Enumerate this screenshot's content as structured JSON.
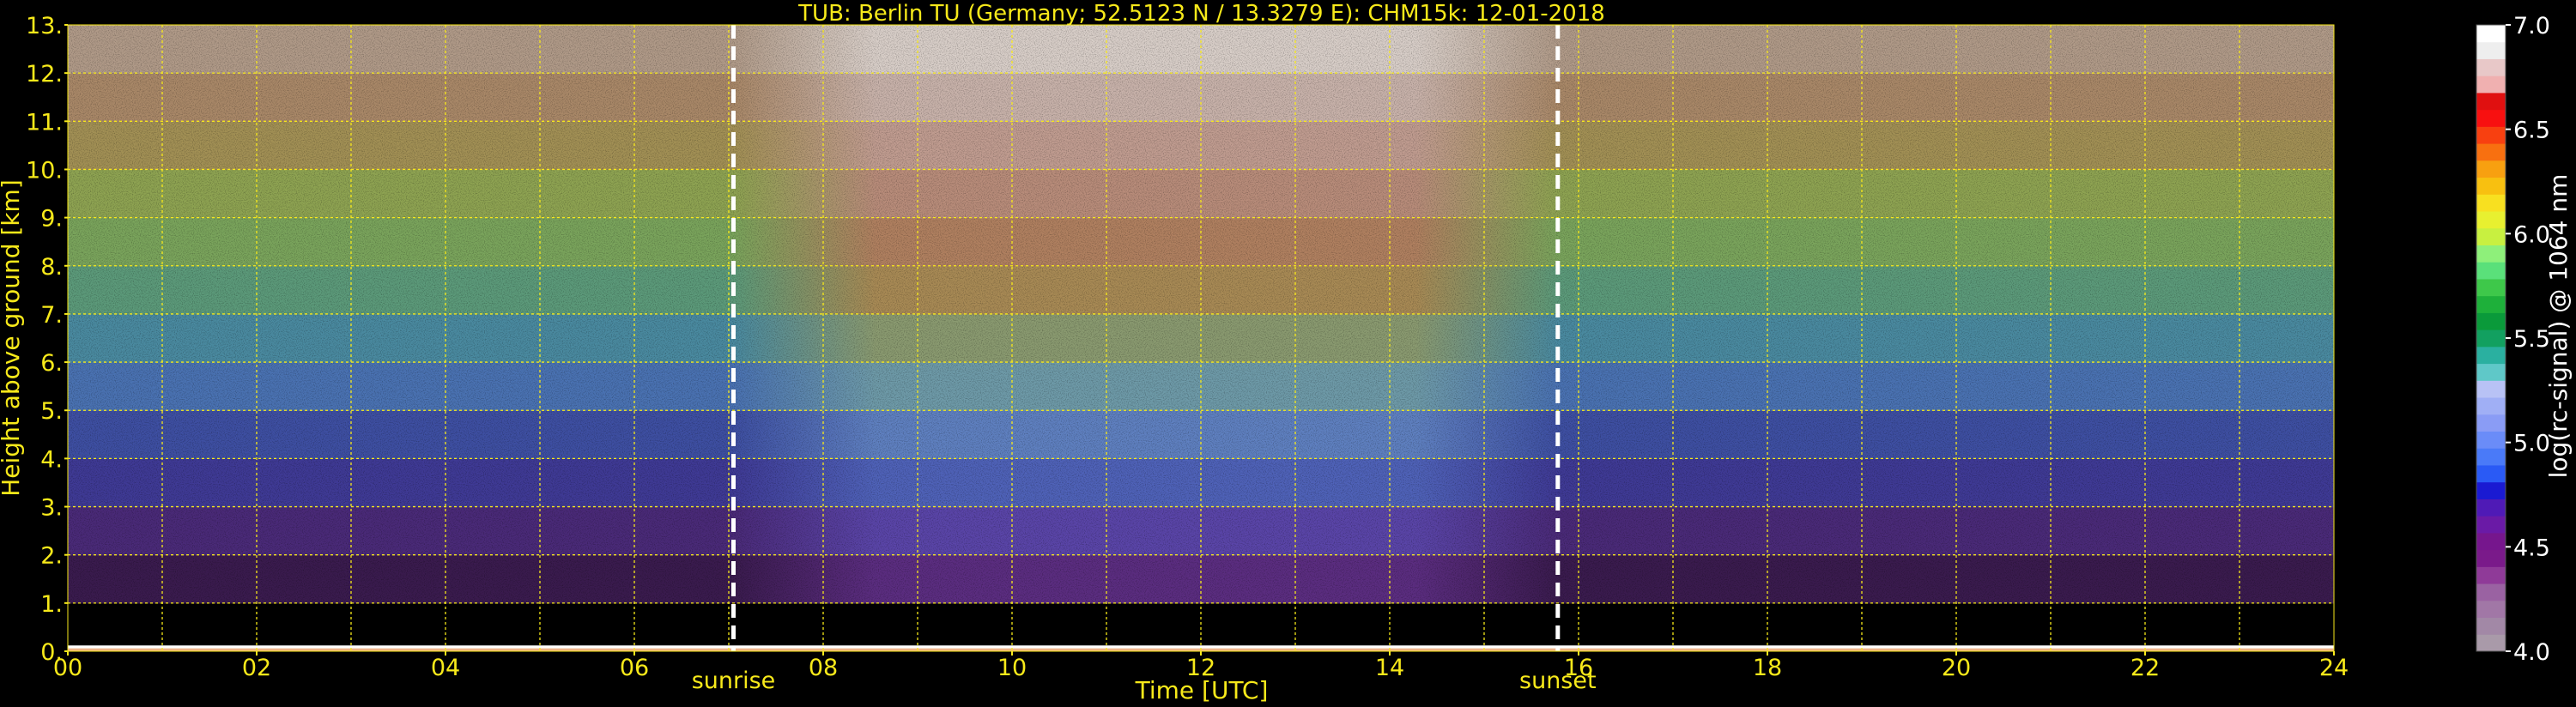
{
  "chart_data": {
    "type": "heatmap",
    "title": "TUB: Berlin TU (Germany; 52.5123 N / 13.3279 E):    CHM15k: 12-01-2018",
    "xlabel": "Time [UTC]",
    "ylabel": "Height above ground [km]",
    "xlim": [
      0,
      24
    ],
    "ylim": [
      0,
      13
    ],
    "x_ticks": [
      "00",
      "02",
      "04",
      "06",
      "08",
      "10",
      "12",
      "14",
      "16",
      "18",
      "20",
      "22",
      "24"
    ],
    "y_ticks": [
      "0.",
      "1.",
      "2.",
      "3.",
      "4.",
      "5.",
      "6.",
      "7.",
      "8.",
      "9.",
      "10.",
      "11.",
      "12.",
      "13."
    ],
    "grid": true,
    "markers": [
      {
        "label": "sunrise",
        "time": 7.05
      },
      {
        "label": "sunset",
        "time": 15.78
      }
    ],
    "colorbar": {
      "label": "log(rc-signal) @ 1064 nm",
      "range": [
        4.0,
        7.0
      ],
      "ticks": [
        "4.0",
        "4.5",
        "5.0",
        "5.5",
        "6.0",
        "6.5",
        "7.0"
      ],
      "colors": [
        "#a99aa9",
        "#a288a6",
        "#a177a6",
        "#9a62a2",
        "#8f3a98",
        "#7a1a8a",
        "#76168d",
        "#6a1aa6",
        "#4f1ab6",
        "#1a1ad2",
        "#2a5af5",
        "#4a7af8",
        "#6a8cf8",
        "#8a9cf5",
        "#a0aff5",
        "#b8c2f5",
        "#5fc8c8",
        "#2ab0a0",
        "#12a060",
        "#0a9a3a",
        "#1eb03a",
        "#3ec84a",
        "#5ae07a",
        "#8ef07a",
        "#c8f040",
        "#e8f030",
        "#f8e020",
        "#f8c010",
        "#f8a010",
        "#f87010",
        "#f84010",
        "#f81010",
        "#e01010",
        "#f0b0b0",
        "#e8c8c8",
        "#eeeeee",
        "#ffffff"
      ]
    },
    "surface_layer_top_km": 0.12,
    "profile": [
      {
        "height_km": 0.5,
        "night": "#000000",
        "day": "#000000"
      },
      {
        "height_km": 1.5,
        "night": "#3a1b4e",
        "day": "#5b2d80"
      },
      {
        "height_km": 2.5,
        "night": "#4a2a78",
        "day": "#5a45a8"
      },
      {
        "height_km": 3.5,
        "night": "#3f3a95",
        "day": "#4f62b8"
      },
      {
        "height_km": 4.5,
        "night": "#3e4fa2",
        "day": "#5f80c0"
      },
      {
        "height_km": 5.5,
        "night": "#4a72b2",
        "day": "#6e9aa8"
      },
      {
        "height_km": 6.5,
        "night": "#4a8aa0",
        "day": "#8a9a70"
      },
      {
        "height_km": 7.5,
        "night": "#5c9a7a",
        "day": "#a88a55"
      },
      {
        "height_km": 8.5,
        "night": "#7aa45c",
        "day": "#b08060"
      },
      {
        "height_km": 9.5,
        "night": "#8ea352",
        "day": "#b88c7a"
      },
      {
        "height_km": 10.5,
        "night": "#a29055",
        "day": "#c09c90"
      },
      {
        "height_km": 11.5,
        "night": "#a98868",
        "day": "#c8b2aa"
      },
      {
        "height_km": 12.5,
        "night": "#b09a88",
        "day": "#d8cec8"
      }
    ]
  }
}
